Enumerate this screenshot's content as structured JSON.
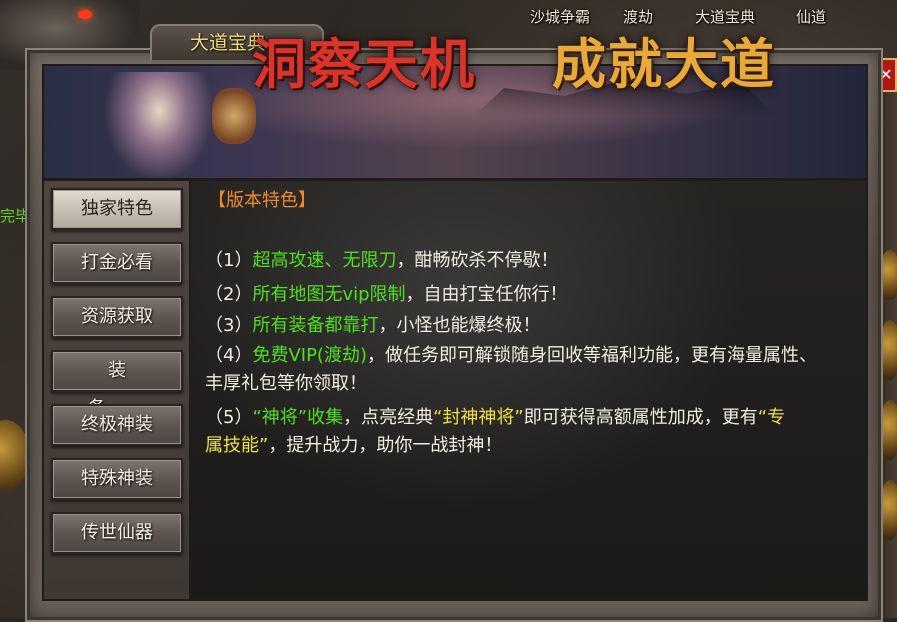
{
  "top_menu": {
    "items": [
      {
        "label": "沙城争霸"
      },
      {
        "label": "渡劫"
      },
      {
        "label": "大道宝典"
      },
      {
        "label": "仙道"
      }
    ]
  },
  "side_text": "完毕",
  "window": {
    "title": "大道宝典",
    "banner": {
      "left": "洞察天机",
      "right": "成就大道"
    }
  },
  "sidebar": {
    "items": [
      {
        "label": "独家特色",
        "active": true
      },
      {
        "label": "打金必看"
      },
      {
        "label": "资源获取"
      },
      {
        "label": "装备"
      },
      {
        "label": "终极神装"
      },
      {
        "label": "特殊神装"
      },
      {
        "label": "传世仙器"
      }
    ]
  },
  "content": {
    "section_title": "【版本特色】",
    "lines": [
      {
        "prefix": "（1）",
        "highlight": "超高攻速、无限刀",
        "rest": "，酣畅砍杀不停歇！"
      },
      {
        "prefix": "（2）",
        "highlight": "所有地图无vip限制",
        "rest": "，自由打宝任你行！"
      },
      {
        "prefix": "（3）",
        "highlight": "所有装备都靠打",
        "rest": "，小怪也能爆终极！"
      },
      {
        "prefix": "（4）",
        "highlight": "免费VIP(渡劫)",
        "rest": "，做任务即可解锁随身回收等福利功能，更有海量属性、丰厚礼包等你领取！"
      },
      {
        "prefix": "（5）",
        "hl1": "“神将”收集",
        "mid": "，点亮经典",
        "hl2": "“封神神将”",
        "rest_a": "即可获得高额属性加成，更有",
        "hl3": "“专属技能”",
        "rest_b": "，提升战力，助你一战封神！"
      }
    ]
  },
  "colors": {
    "title_gold": "#f0d77e",
    "section_orange": "#f08a2a",
    "highlight_green": "#4fe020",
    "highlight_yellow": "#f0e040"
  }
}
